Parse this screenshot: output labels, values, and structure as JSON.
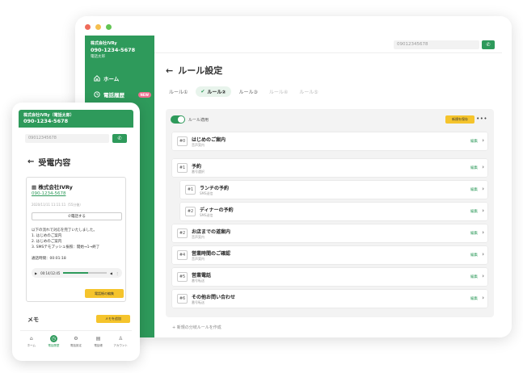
{
  "colors": {
    "brand": "#2e9a5b",
    "accent": "#f5c42c",
    "badge": "#f06d8f"
  },
  "window_dots": [
    "#ef6b5a",
    "#f5bf4f",
    "#62c554"
  ],
  "tablet": {
    "sidebar": {
      "company": "株式会社IVRy",
      "phone": "090-1234-5678",
      "user": "電話太郎",
      "nav": [
        {
          "label": "ホーム",
          "icon": "home-icon"
        },
        {
          "label": "電話履歴",
          "icon": "clock-icon",
          "badge": "NEW"
        }
      ]
    },
    "top": {
      "phone_input": "09012345678",
      "call_icon": "phone-icon"
    },
    "title": "ルール設定",
    "tabs": [
      "ルール①",
      "ルール②",
      "ルール③",
      "ルール④",
      "ルール⑤"
    ],
    "panel": {
      "toggle_label": "ルール適用",
      "save_label": "新規を保存",
      "more": "•••",
      "rules": [
        {
          "num": "#0",
          "name": "はじめのご案内",
          "sub": "音声案内",
          "edit": "編集"
        },
        {
          "num": "#1",
          "name": "予約",
          "sub": "番号選択",
          "edit": "編集"
        },
        {
          "num": "#1",
          "name": "ランチの予約",
          "sub": "SMS送信",
          "edit": "編集"
        },
        {
          "num": "#2",
          "name": "ディナーの予約",
          "sub": "SMS送信",
          "edit": "編集"
        },
        {
          "num": "#2",
          "name": "お店までの道案内",
          "sub": "音声案内",
          "edit": "編集"
        },
        {
          "num": "#4",
          "name": "営業時間のご確認",
          "sub": "音声案内",
          "edit": "編集"
        },
        {
          "num": "#5",
          "name": "営業電話",
          "sub": "番号転送",
          "edit": "編集"
        },
        {
          "num": "#6",
          "name": "その他お問い合わせ",
          "sub": "番号転送",
          "edit": "編集"
        }
      ],
      "add_rule": "+ 新規の分岐ルールを作成"
    }
  },
  "phone": {
    "company": "株式会社IVRy（電話太郎）",
    "phone": "090-1234-5678",
    "input": "09012345678",
    "title": "受電内容",
    "card": {
      "company": "株式会社IVRy",
      "phone": "090-1234-5678",
      "datetime": "2020/11/11 11:11:11（55分後）",
      "call_btn": "電話する",
      "lines": [
        "以下の流れで対応を完了いたしました。",
        "1. はじめのご案内",
        "2. はじめのご案内",
        "3. SMSテモプッシュ振照：開始→1→終了"
      ],
      "duration": "通話時間：00:01:18",
      "audio_time": "00:14/12:45",
      "audio_progress": 0.58,
      "edit_btn": "電話帳の編集"
    },
    "memo": "メモ",
    "memo_btn": "メモを追加",
    "nav": [
      {
        "label": "ホーム",
        "icon": "home-icon"
      },
      {
        "label": "電話履歴",
        "icon": "clock-icon"
      },
      {
        "label": "電話設定",
        "icon": "gear-icon"
      },
      {
        "label": "電話帳",
        "icon": "book-icon"
      },
      {
        "label": "アカウント",
        "icon": "user-icon"
      }
    ]
  }
}
